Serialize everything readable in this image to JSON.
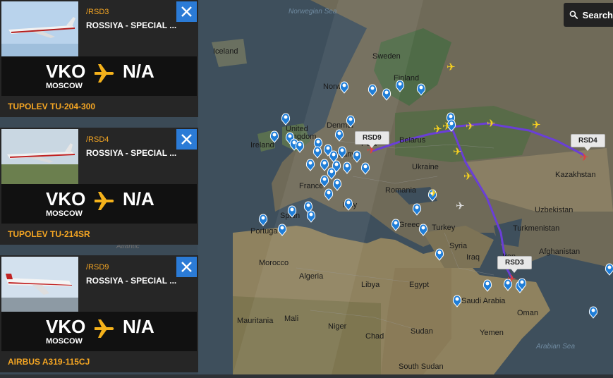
{
  "search": {
    "label": "Search"
  },
  "flights": [
    {
      "callsign": "/RSD3",
      "airline": "ROSSIYA - SPECIAL ...",
      "from": "VKO",
      "from_city": "MOSCOW",
      "to": "N/A",
      "aircraft": "TUPOLEV TU-204-300"
    },
    {
      "callsign": "/RSD4",
      "airline": "ROSSIYA - SPECIAL ...",
      "from": "VKO",
      "from_city": "MOSCOW",
      "to": "N/A",
      "aircraft": "TUPOLEV TU-214SR"
    },
    {
      "callsign": "/RSD9",
      "airline": "ROSSIYA - SPECIAL ...",
      "from": "VKO",
      "from_city": "MOSCOW",
      "to": "N/A",
      "aircraft": "AIRBUS A319-115CJ"
    }
  ],
  "map_tags": {
    "rsd9": "RSD9",
    "rsd4": "RSD4",
    "rsd3": "RSD3"
  },
  "map_labels": {
    "norwegian_sea": "Norwegian Sea",
    "iceland": "Iceland",
    "sweden": "Sweden",
    "finland": "Finland",
    "norway": "Norw",
    "denmark": "Denmar",
    "united_kingdom": "United\nKingdom",
    "ireland": "Ireland",
    "germany": "many",
    "belarus": "Belarus",
    "poland": "Pola",
    "ukraine": "Ukraine",
    "kazakhstan": "Kazakhstan",
    "france": "France",
    "romania": "Romania",
    "italy": "Italy",
    "spain": "Spain",
    "portugal": "Portuga",
    "greece": "Greec",
    "turkey": "Turkey",
    "turkmenistan": "Turkmenistan",
    "uzbekistan": "Uzbekistan",
    "afghanistan": "Afghanistan",
    "north_atlantic": "North\nAtlantic",
    "syria": "Syria",
    "iraq": "Iraq",
    "iran": "Iran",
    "morocco": "Morocco",
    "algeria": "Algeria",
    "libya": "Libya",
    "egypt": "Egypt",
    "saudi_arabia": "Saudi Arabia",
    "oman": "Oman",
    "mauritania": "Mauritania",
    "mali": "Mali",
    "niger": "Niger",
    "chad": "Chad",
    "sudan": "Sudan",
    "yemen": "Yemen",
    "arabian_sea": "Arabian Sea",
    "south_sudan": "South Sudan"
  },
  "colors": {
    "accent": "#f5a623",
    "close": "#2b7bd6",
    "route": "#6a3fd6",
    "plane": "#f5d020"
  }
}
